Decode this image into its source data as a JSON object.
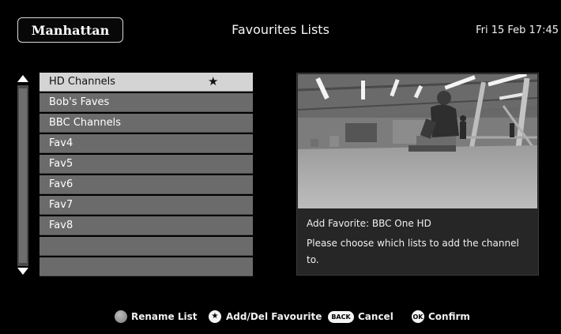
{
  "header": {
    "logo": "Manhattan",
    "title": "Favourites Lists",
    "datetime": "Fri 15 Feb 17:45"
  },
  "list": {
    "items": [
      {
        "label": "HD Channels",
        "selected": true,
        "starred": true
      },
      {
        "label": "Bob's Faves",
        "selected": false,
        "starred": false
      },
      {
        "label": "BBC Channels",
        "selected": false,
        "starred": false
      },
      {
        "label": "Fav4",
        "selected": false,
        "starred": false
      },
      {
        "label": "Fav5",
        "selected": false,
        "starred": false
      },
      {
        "label": "Fav6",
        "selected": false,
        "starred": false
      },
      {
        "label": "Fav7",
        "selected": false,
        "starred": false
      },
      {
        "label": "Fav8",
        "selected": false,
        "starred": false
      },
      {
        "label": "",
        "selected": false,
        "starred": false
      },
      {
        "label": "",
        "selected": false,
        "starred": false
      }
    ],
    "star_glyph": "★"
  },
  "dialog": {
    "title": "Add Favorite: BBC One HD",
    "message": "Please choose which lists to add the channel to."
  },
  "footer": {
    "rename": {
      "label": "Rename List",
      "icon": "grey-button-icon"
    },
    "add_del": {
      "label": "Add/Del Favourite",
      "icon_glyph": "★",
      "icon": "star-button-icon"
    },
    "cancel": {
      "label": "Cancel",
      "badge": "BACK",
      "icon": "back-button-icon"
    },
    "confirm": {
      "label": "Confirm",
      "badge": "OK",
      "icon": "ok-button-icon"
    }
  },
  "colors": {
    "background": "#000000",
    "list_item": "#6b6b6b",
    "list_item_selected": "#d4d4d4",
    "panel": "#262626"
  }
}
